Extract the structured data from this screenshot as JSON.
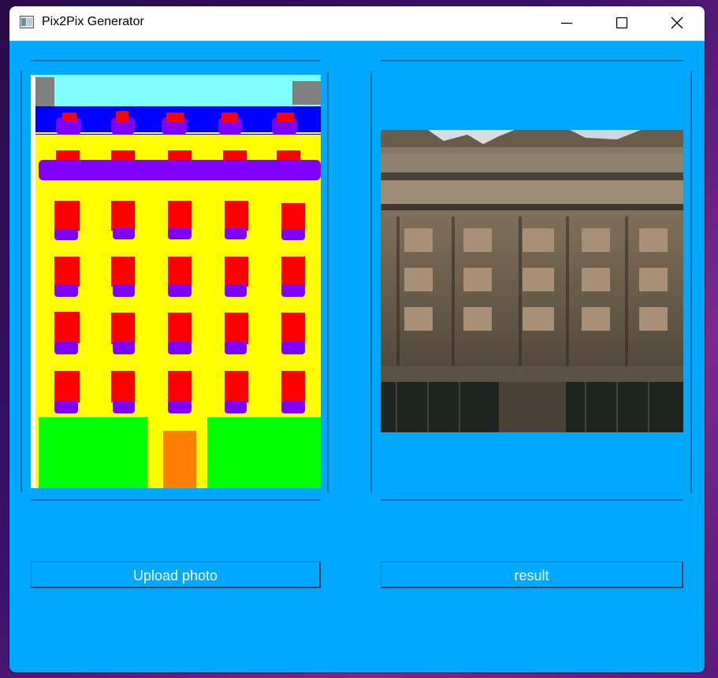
{
  "window": {
    "title": "Pix2Pix Generator"
  },
  "icons": {
    "app": "app-window-icon",
    "minimize": "minimize-icon",
    "maximize": "maximize-icon",
    "close": "close-icon"
  },
  "colors": {
    "background": "#00a8ff",
    "sky": "#80ffff",
    "facade": "#ffff00",
    "cornice": "#0000ff",
    "window": "#ff0000",
    "sill": "#8000ff",
    "shop": "#00ff00",
    "door": "#ff8000",
    "gray": "#808080"
  },
  "left_panel": {
    "image_name": "segmentation-label-map",
    "button_label": "Upload photo"
  },
  "right_panel": {
    "image_name": "generated-facade-photo",
    "button_label": "result"
  }
}
